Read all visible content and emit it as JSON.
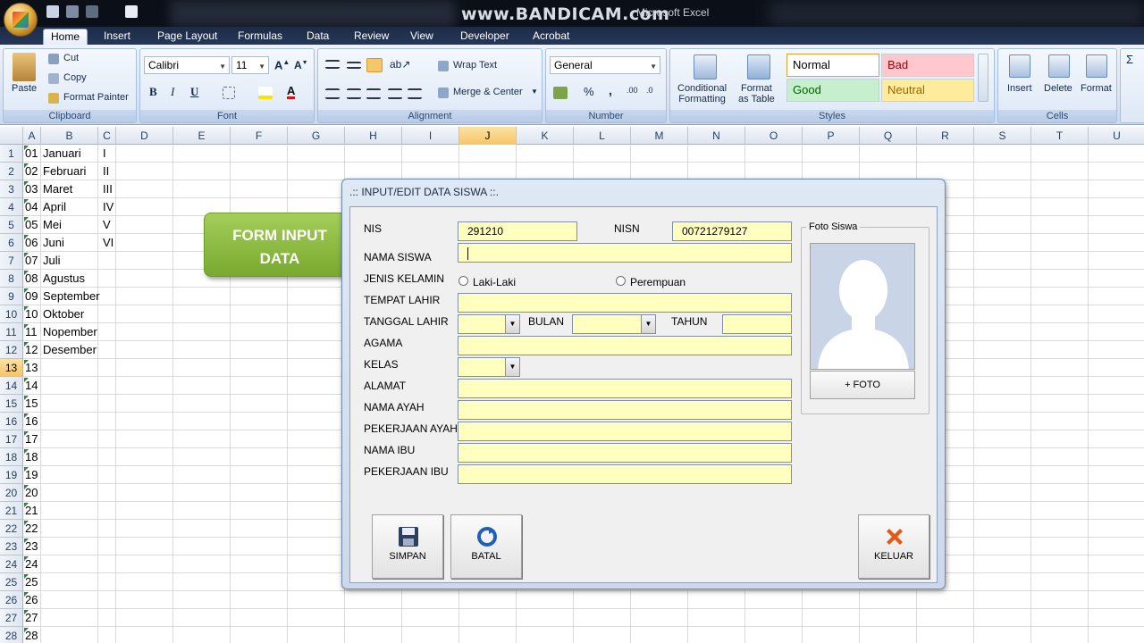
{
  "watermark": "www.BANDICAM.com",
  "app_title": "Microsoft Excel",
  "ribbon": {
    "tabs": [
      "Home",
      "Insert",
      "Page Layout",
      "Formulas",
      "Data",
      "Review",
      "View",
      "Developer",
      "Acrobat"
    ],
    "clipboard": {
      "paste": "Paste",
      "cut": "Cut",
      "copy": "Copy",
      "format_painter": "Format Painter",
      "label": "Clipboard"
    },
    "font": {
      "name": "Calibri",
      "size": "11",
      "bold": "B",
      "italic": "I",
      "underline": "U",
      "label": "Font"
    },
    "alignment": {
      "wrap_text": "Wrap Text",
      "merge_center": "Merge & Center",
      "label": "Alignment"
    },
    "number": {
      "format": "General",
      "percent": "%",
      "comma": ",",
      "label": "Number"
    },
    "styles": {
      "conditional": "Conditional",
      "conditional2": "Formatting",
      "format_table": "Format",
      "format_table2": "as Table",
      "normal": "Normal",
      "bad": "Bad",
      "good": "Good",
      "neutral": "Neutral",
      "label": "Styles"
    },
    "cells": {
      "insert": "Insert",
      "delete": "Delete",
      "format": "Format",
      "label": "Cells"
    }
  },
  "sheet": {
    "columns": [
      "A",
      "B",
      "C",
      "D",
      "E",
      "F",
      "G",
      "H",
      "I",
      "J",
      "K",
      "L",
      "M",
      "N",
      "O",
      "P",
      "Q",
      "R",
      "S",
      "T",
      "U"
    ],
    "selected_column": "J",
    "selected_row": "13",
    "rows": [
      {
        "n": "1",
        "a": "01",
        "b": "Januari",
        "c": "I"
      },
      {
        "n": "2",
        "a": "02",
        "b": "Februari",
        "c": "II"
      },
      {
        "n": "3",
        "a": "03",
        "b": "Maret",
        "c": "III"
      },
      {
        "n": "4",
        "a": "04",
        "b": "April",
        "c": "IV"
      },
      {
        "n": "5",
        "a": "05",
        "b": "Mei",
        "c": "V"
      },
      {
        "n": "6",
        "a": "06",
        "b": "Juni",
        "c": "VI"
      },
      {
        "n": "7",
        "a": "07",
        "b": "Juli",
        "c": ""
      },
      {
        "n": "8",
        "a": "08",
        "b": "Agustus",
        "c": ""
      },
      {
        "n": "9",
        "a": "09",
        "b": "September",
        "c": ""
      },
      {
        "n": "10",
        "a": "10",
        "b": "Oktober",
        "c": ""
      },
      {
        "n": "11",
        "a": "11",
        "b": "Nopember",
        "c": ""
      },
      {
        "n": "12",
        "a": "12",
        "b": "Desember",
        "c": ""
      },
      {
        "n": "13",
        "a": "13",
        "b": "",
        "c": ""
      },
      {
        "n": "14",
        "a": "14",
        "b": "",
        "c": ""
      },
      {
        "n": "15",
        "a": "15",
        "b": "",
        "c": ""
      },
      {
        "n": "16",
        "a": "16",
        "b": "",
        "c": ""
      },
      {
        "n": "17",
        "a": "17",
        "b": "",
        "c": ""
      },
      {
        "n": "18",
        "a": "18",
        "b": "",
        "c": ""
      },
      {
        "n": "19",
        "a": "19",
        "b": "",
        "c": ""
      },
      {
        "n": "20",
        "a": "20",
        "b": "",
        "c": ""
      },
      {
        "n": "21",
        "a": "21",
        "b": "",
        "c": ""
      },
      {
        "n": "22",
        "a": "22",
        "b": "",
        "c": ""
      },
      {
        "n": "23",
        "a": "23",
        "b": "",
        "c": ""
      },
      {
        "n": "24",
        "a": "24",
        "b": "",
        "c": ""
      },
      {
        "n": "25",
        "a": "25",
        "b": "",
        "c": ""
      },
      {
        "n": "26",
        "a": "26",
        "b": "",
        "c": ""
      },
      {
        "n": "27",
        "a": "27",
        "b": "",
        "c": ""
      },
      {
        "n": "28",
        "a": "28",
        "b": "",
        "c": ""
      }
    ],
    "form_button": {
      "line1": "FORM INPUT",
      "line2": "DATA"
    }
  },
  "dialog": {
    "title": ".:: INPUT/EDIT DATA SISWA ::.",
    "nis_label": "NIS",
    "nis_value": "291210",
    "nisn_label": "NISN",
    "nisn_value": "00721279127",
    "nama_label": "NAMA SISWA",
    "nama_value": "",
    "jk_label": "JENIS KELAMIN",
    "jk_male": "Laki-Laki",
    "jk_female": "Perempuan",
    "tempat_label": "TEMPAT LAHIR",
    "tanggal_label": "TANGGAL LAHIR",
    "bulan_label": "BULAN",
    "tahun_label": "TAHUN",
    "agama_label": "AGAMA",
    "kelas_label": "KELAS",
    "alamat_label": "ALAMAT",
    "ayah_label": "NAMA AYAH",
    "kerja_ayah_label": "PEKERJAAN AYAH",
    "ibu_label": "NAMA IBU",
    "kerja_ibu_label": "PEKERJAAN IBU",
    "foto_group": "Foto Siswa",
    "foto_button": "+ FOTO",
    "save_button": "SIMPAN",
    "cancel_button": "BATAL",
    "exit_button": "KELUAR"
  }
}
